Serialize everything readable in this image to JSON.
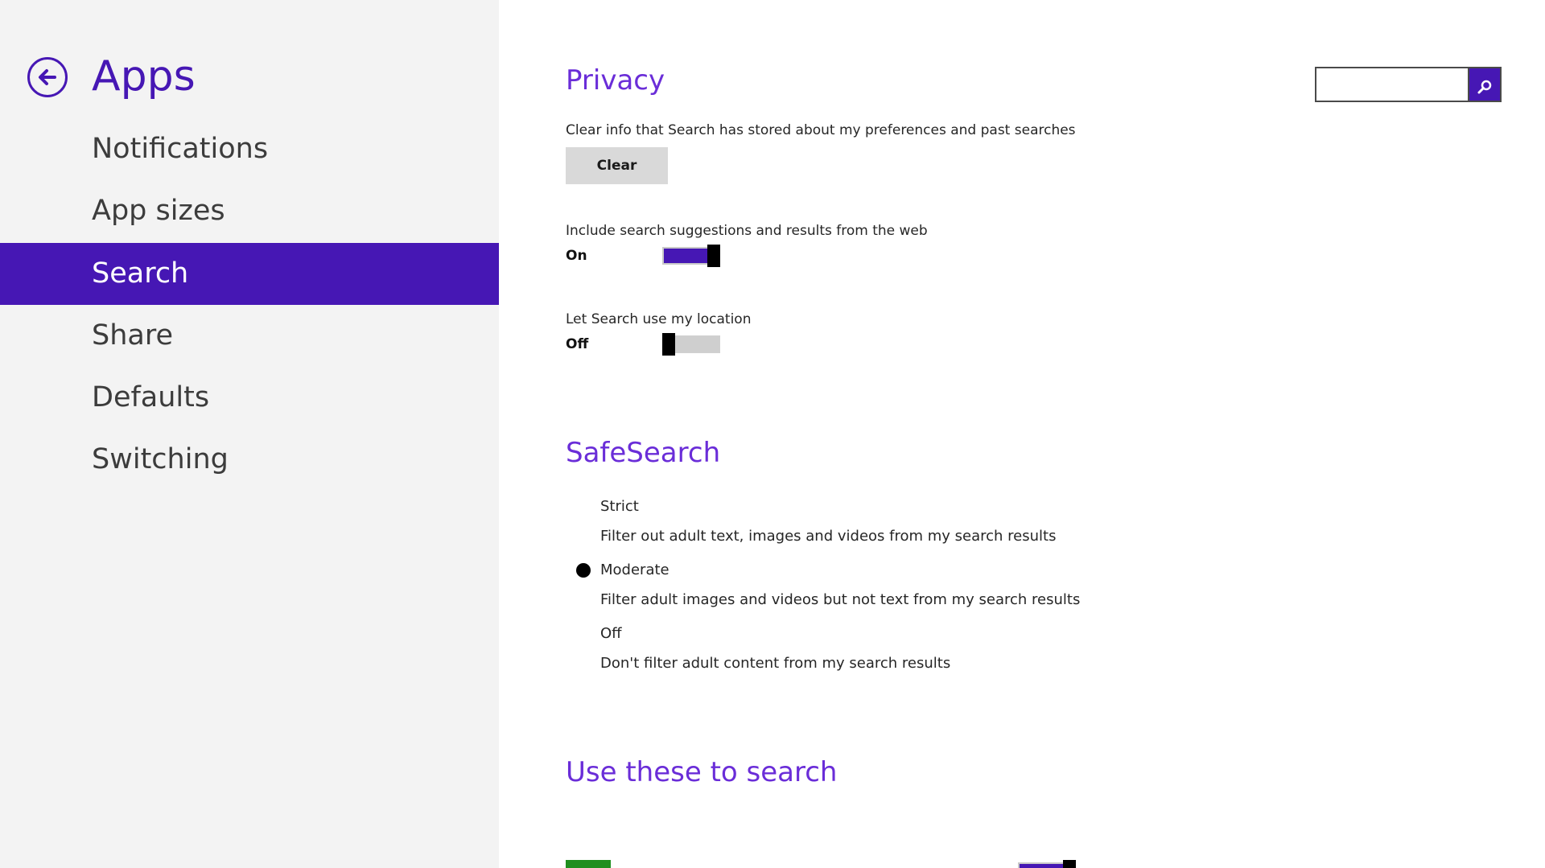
{
  "colors": {
    "accent": "#4617b4",
    "section_title": "#6a2dd8",
    "sidebar_bg": "#f3f3f3",
    "toggle_off": "#cfcfcf",
    "app_tile": "#1f8f1f"
  },
  "sidebar": {
    "back_icon": "back-arrow-circle-icon",
    "title": "Apps",
    "items": [
      {
        "label": "Notifications",
        "selected": false
      },
      {
        "label": "App sizes",
        "selected": false
      },
      {
        "label": "Search",
        "selected": true
      },
      {
        "label": "Share",
        "selected": false
      },
      {
        "label": "Defaults",
        "selected": false
      },
      {
        "label": "Switching",
        "selected": false
      }
    ]
  },
  "search_box": {
    "value": "",
    "placeholder": "",
    "icon": "search-icon"
  },
  "privacy": {
    "title": "Privacy",
    "clear_description": "Clear info that Search has stored about my preferences and past searches",
    "clear_button": "Clear",
    "web_suggestions": {
      "label": "Include search suggestions and results from the web",
      "state": "On",
      "on": true
    },
    "location": {
      "label": "Let Search use my location",
      "state": "Off",
      "on": false
    }
  },
  "safesearch": {
    "title": "SafeSearch",
    "options": [
      {
        "label": "Strict",
        "description": "Filter out adult text, images and videos from my search results",
        "selected": false
      },
      {
        "label": "Moderate",
        "description": "Filter adult images and videos but not text from my search results",
        "selected": true
      },
      {
        "label": "Off",
        "description": "Don't filter adult content from my search results",
        "selected": false
      }
    ]
  },
  "use_these": {
    "title": "Use these to search"
  }
}
